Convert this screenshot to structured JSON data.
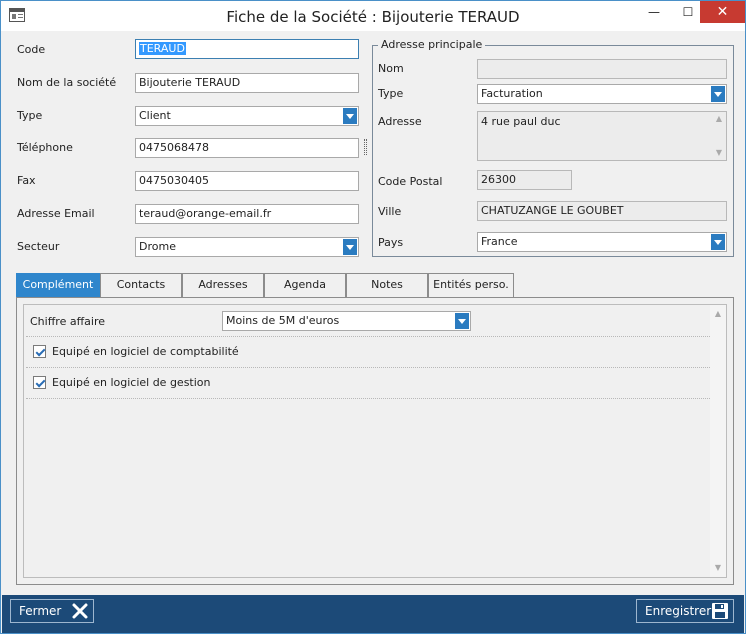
{
  "window": {
    "title": "Fiche de la Société : Bijouterie TERAUD",
    "minimize_glyph": "—",
    "maximize_glyph": "☐",
    "close_glyph": "✕"
  },
  "icons": {
    "app": "form-window-icon",
    "close_action": "x-icon",
    "save_action": "floppy-disk-icon"
  },
  "colors": {
    "accent": "#2f86cc",
    "footer": "#1c4a78",
    "selection": "#3399ff",
    "close_button": "#c73a31"
  },
  "form": {
    "code_label": "Code",
    "code_value": "TERAUD",
    "name_label": "Nom de la société",
    "name_value": "Bijouterie TERAUD",
    "type_label": "Type",
    "type_value": "Client",
    "phone_label": "Téléphone",
    "phone_value": "0475068478",
    "fax_label": "Fax",
    "fax_value": "0475030405",
    "email_label": "Adresse Email",
    "email_value": "teraud@orange-email.fr",
    "sector_label": "Secteur",
    "sector_value": "Drome"
  },
  "address": {
    "group_title": "Adresse principale",
    "nom_label": "Nom",
    "nom_value": "",
    "type_label": "Type",
    "type_value": "Facturation",
    "adresse_label": "Adresse",
    "adresse_value": "4 rue paul duc",
    "cp_label": "Code Postal",
    "cp_value": "26300",
    "ville_label": "Ville",
    "ville_value": "CHATUZANGE LE GOUBET",
    "pays_label": "Pays",
    "pays_value": "France"
  },
  "tabs": [
    {
      "label": "Complément"
    },
    {
      "label": "Contacts"
    },
    {
      "label": "Adresses"
    },
    {
      "label": "Agenda"
    },
    {
      "label": "Notes"
    },
    {
      "label": "Entités perso."
    }
  ],
  "complement": {
    "ca_label": "Chiffre affaire",
    "ca_value": "Moins de 5M d'euros",
    "compta_label": "Equipé en logiciel de comptabilité",
    "compta_checked": true,
    "gestion_label": "Equipé en logiciel de gestion",
    "gestion_checked": true
  },
  "footer": {
    "close_label": "Fermer",
    "save_label": "Enregistrer"
  }
}
